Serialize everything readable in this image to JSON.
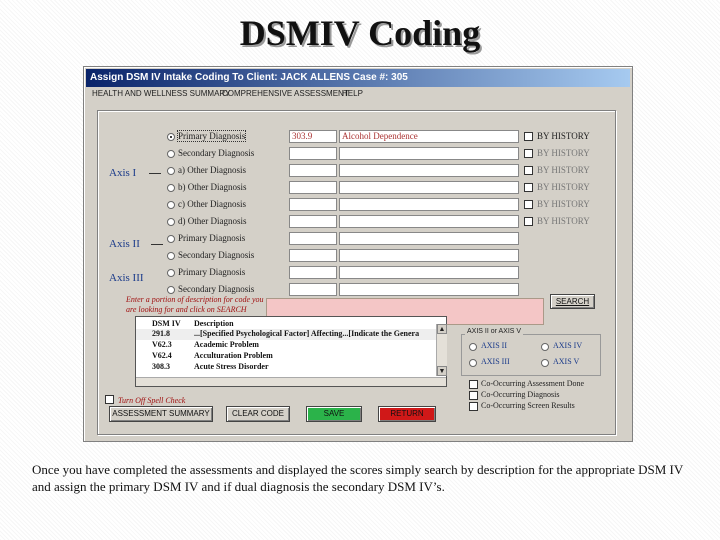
{
  "slide": {
    "title": "DSMIV Coding",
    "caption": "Once you have completed the assessments and displayed the scores simply search by description for the appropriate DSM IV and assign the primary DSM IV and if dual diagnosis the secondary DSM IV’s."
  },
  "window": {
    "title": "Assign DSM IV Intake Coding To Client: JACK ALLENS   Case #: 305",
    "menu": [
      "HEALTH AND WELLNESS SUMMARY",
      "COMPREHENSIVE ASSESSMENT",
      "HELP"
    ]
  },
  "axes": {
    "axis1": "Axis I",
    "axis2": "Axis II",
    "axis3": "Axis III"
  },
  "diagnoses": [
    {
      "label": "Primary Diagnosis",
      "code": "303.9",
      "description": "Alcohol Dependence",
      "history": "BY HISTORY"
    },
    {
      "label": "Secondary Diagnosis",
      "code": "",
      "description": "",
      "history": "BY HISTORY"
    },
    {
      "label": "a) Other Diagnosis",
      "code": "",
      "description": "",
      "history": "BY HISTORY"
    },
    {
      "label": "b) Other Diagnosis",
      "code": "",
      "description": "",
      "history": "BY HISTORY"
    },
    {
      "label": "c) Other Diagnosis",
      "code": "",
      "description": "",
      "history": "BY HISTORY"
    },
    {
      "label": "d) Other Diagnosis",
      "code": "",
      "description": "",
      "history": "BY HISTORY"
    },
    {
      "label": "Primary Diagnosis",
      "code": "",
      "description": ""
    },
    {
      "label": "Secondary Diagnosis",
      "code": "",
      "description": ""
    },
    {
      "label": "Primary Diagnosis",
      "code": "",
      "description": ""
    },
    {
      "label": "Secondary Diagnosis",
      "code": "",
      "description": ""
    }
  ],
  "search": {
    "hint_line1": "Enter a portion of description for code you",
    "hint_line2": "are looking for and click on SEARCH",
    "value": "",
    "button": "SEARCH"
  },
  "results": {
    "columns": [
      "DSM IV",
      "Description"
    ],
    "rows": [
      {
        "code": "291.8",
        "description": "...[Specified Psychological Factor] Affecting...[Indicate the Genera"
      },
      {
        "code": "V62.3",
        "description": "Academic Problem"
      },
      {
        "code": "V62.4",
        "description": "Acculturation Problem"
      },
      {
        "code": "308.3",
        "description": "Acute Stress Disorder"
      }
    ]
  },
  "axis_options": {
    "legend": "AXIS II or AXIS V",
    "options": [
      "AXIS II",
      "AXIS IV",
      "AXIS III",
      "AXIS V"
    ]
  },
  "checks": [
    "Co-Occurring Assessment Done",
    "Co-Occurring Diagnosis",
    "Co-Occurring Screen Results"
  ],
  "spell_check": "Turn Off Spell Check",
  "buttons": {
    "summary": "ASSESSMENT SUMMARY",
    "clear": "CLEAR CODE",
    "save": "SAVE",
    "return": "RETURN"
  },
  "colors": {
    "save": "#2bb34a",
    "return": "#d01818",
    "search_field": "#f4c6c6",
    "axis_text": "#1a3a8a"
  }
}
